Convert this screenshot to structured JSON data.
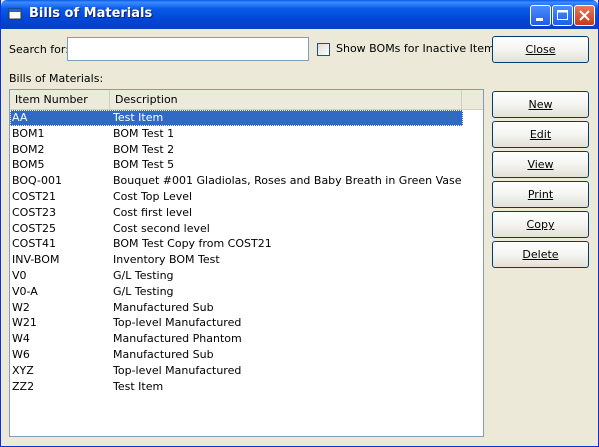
{
  "window": {
    "title": "Bills of Materials"
  },
  "search": {
    "label": "Search for:",
    "value": "",
    "placeholder": ""
  },
  "checkbox": {
    "label": "Show BOMs for Inactive Items",
    "checked": false
  },
  "list_label": "Bills of Materials:",
  "columns": [
    "Item Number",
    "Description"
  ],
  "rows": [
    {
      "item": "AA",
      "description": "Test Item",
      "selected": true
    },
    {
      "item": "BOM1",
      "description": "BOM Test 1"
    },
    {
      "item": "BOM2",
      "description": "BOM Test 2"
    },
    {
      "item": "BOM5",
      "description": "BOM Test 5"
    },
    {
      "item": "BOQ-001",
      "description": "Bouquet #001 Gladiolas, Roses and Baby Breath in Green Vase"
    },
    {
      "item": "COST21",
      "description": "Cost Top Level"
    },
    {
      "item": "COST23",
      "description": "Cost first level"
    },
    {
      "item": "COST25",
      "description": "Cost second level"
    },
    {
      "item": "COST41",
      "description": "BOM Test Copy from COST21"
    },
    {
      "item": "INV-BOM",
      "description": "Inventory BOM Test"
    },
    {
      "item": "V0",
      "description": "G/L Testing"
    },
    {
      "item": "V0-A",
      "description": "G/L Testing"
    },
    {
      "item": "W2",
      "description": "Manufactured Sub"
    },
    {
      "item": "W21",
      "description": "Top-level Manufactured"
    },
    {
      "item": "W4",
      "description": "Manufactured Phantom"
    },
    {
      "item": "W6",
      "description": "Manufactured Sub"
    },
    {
      "item": "XYZ",
      "description": "Top-level Manufactured"
    },
    {
      "item": "ZZ2",
      "description": "Test Item"
    }
  ],
  "buttons": {
    "close": "Close",
    "new": "New",
    "edit": "Edit",
    "view": "View",
    "print": "Print",
    "copy": "Copy",
    "delete": "Delete"
  },
  "colors": {
    "titlebar": "#0a5ae8",
    "selection": "#316ac5",
    "background": "#ece9d8"
  }
}
